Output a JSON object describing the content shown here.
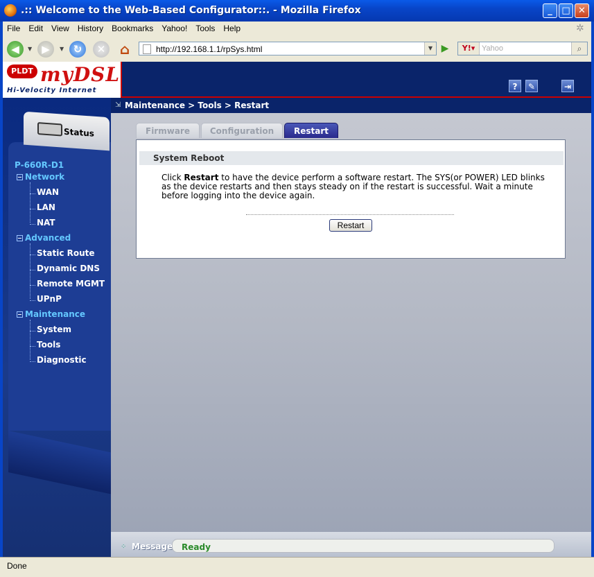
{
  "window": {
    "title": ".:: Welcome to the Web-Based Configurator::. - Mozilla Firefox"
  },
  "menu": {
    "items": [
      "File",
      "Edit",
      "View",
      "History",
      "Bookmarks",
      "Yahoo!",
      "Tools",
      "Help"
    ]
  },
  "toolbar": {
    "url": "http://192.168.1.1/rpSys.html",
    "search_placeholder": "Yahoo"
  },
  "logo": {
    "brand": "PLDT",
    "product": "myDSL",
    "tagline": "Hi-Velocity Internet"
  },
  "header": {
    "help_icon": "?"
  },
  "sidebar": {
    "status_label": "Status",
    "model": "P-660R-D1",
    "groups": [
      {
        "label": "Network",
        "items": [
          "WAN",
          "LAN",
          "NAT"
        ]
      },
      {
        "label": "Advanced",
        "items": [
          "Static Route",
          "Dynamic DNS",
          "Remote MGMT",
          "UPnP"
        ]
      },
      {
        "label": "Maintenance",
        "items": [
          "System",
          "Tools",
          "Diagnostic"
        ]
      }
    ]
  },
  "main": {
    "breadcrumb": "Maintenance > Tools > Restart",
    "tabs": [
      {
        "label": "Firmware",
        "active": false
      },
      {
        "label": "Configuration",
        "active": false
      },
      {
        "label": "Restart",
        "active": true
      }
    ],
    "section_title": "System Reboot",
    "description_prefix": "Click ",
    "description_bold": "Restart",
    "description_suffix": " to have the device perform a software restart. The SYS(or POWER) LED blinks as the device restarts and then stays steady on if the restart is successful. Wait a minute before logging into the device again.",
    "restart_button": "Restart"
  },
  "message": {
    "label": "Message",
    "text": "Ready"
  },
  "statusbar": {
    "text": "Done"
  }
}
